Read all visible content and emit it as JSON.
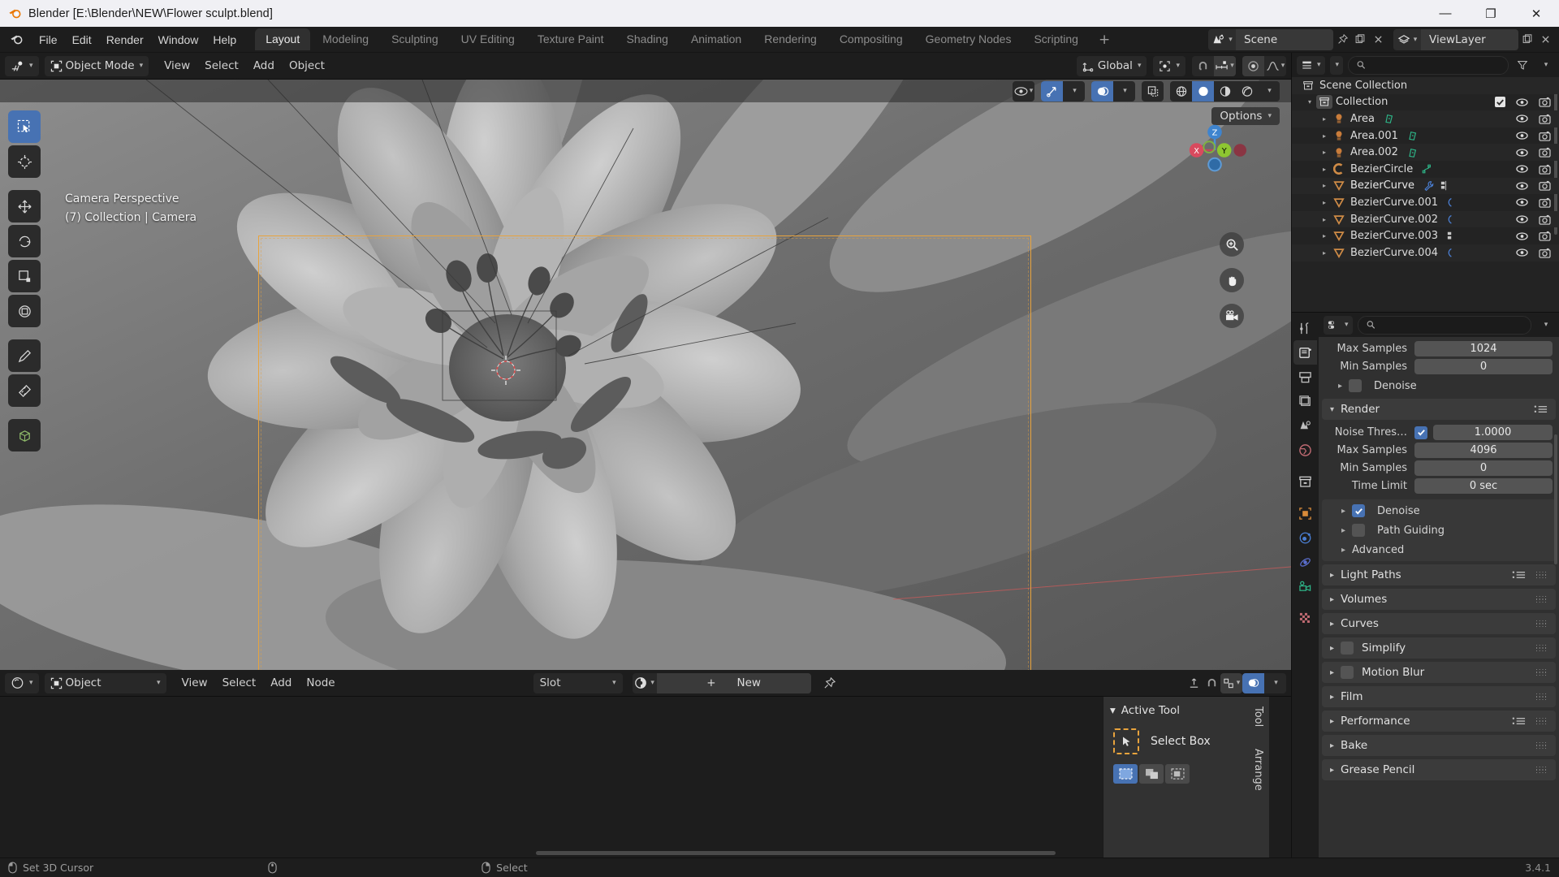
{
  "titlebar": {
    "title": "Blender [E:\\Blender\\NEW\\Flower sculpt.blend]",
    "minimize": "—",
    "maximize": "❐",
    "close": "✕"
  },
  "topbar": {
    "menus": [
      "File",
      "Edit",
      "Render",
      "Window",
      "Help"
    ],
    "workspaces": [
      {
        "label": "Layout",
        "active": true
      },
      {
        "label": "Modeling",
        "active": false
      },
      {
        "label": "Sculpting",
        "active": false
      },
      {
        "label": "UV Editing",
        "active": false
      },
      {
        "label": "Texture Paint",
        "active": false
      },
      {
        "label": "Shading",
        "active": false
      },
      {
        "label": "Animation",
        "active": false
      },
      {
        "label": "Rendering",
        "active": false
      },
      {
        "label": "Compositing",
        "active": false
      },
      {
        "label": "Geometry Nodes",
        "active": false
      },
      {
        "label": "Scripting",
        "active": false
      }
    ],
    "add_workspace": "+",
    "scene_name": "Scene",
    "viewlayer_name": "ViewLayer"
  },
  "viewport": {
    "mode": "Object Mode",
    "menus": [
      "View",
      "Select",
      "Add",
      "Object"
    ],
    "transform_orientation": "Global",
    "options_label": "Options",
    "overlay_line1": "Camera Perspective",
    "overlay_line2": "(7) Collection | Camera",
    "gizmo_axes": {
      "x": "X",
      "y": "Y",
      "z": "Z"
    },
    "accent_camera_frame": "#e8a33d",
    "accent_active": "#4772b3"
  },
  "shader_editor": {
    "editor_type": "Object",
    "menus": [
      "View",
      "Select",
      "Add",
      "Node"
    ],
    "slot_label": "Slot",
    "new_label": "New"
  },
  "npanel": {
    "title": "Active Tool",
    "tool_name": "Select Box",
    "tabs": [
      "Tool",
      "Arrange"
    ]
  },
  "outliner": {
    "search_placeholder": "",
    "rows": [
      {
        "indent": 0,
        "tri": "",
        "icon": "collection-icon",
        "name": "Scene Collection",
        "extras": [],
        "check": false,
        "eye": false,
        "cam": false
      },
      {
        "indent": 1,
        "tri": "▾",
        "icon": "collection-icon",
        "name": "Collection",
        "extras": [],
        "check": true,
        "eye": true,
        "cam": true
      },
      {
        "indent": 2,
        "tri": "▸",
        "icon": "light-icon",
        "name": "Area",
        "extras": [
          "light-data-icon"
        ],
        "eye": true,
        "cam": true
      },
      {
        "indent": 2,
        "tri": "▸",
        "icon": "light-icon",
        "name": "Area.001",
        "extras": [
          "light-data-icon"
        ],
        "eye": true,
        "cam": true
      },
      {
        "indent": 2,
        "tri": "▸",
        "icon": "light-icon",
        "name": "Area.002",
        "extras": [
          "light-data-icon"
        ],
        "eye": true,
        "cam": true
      },
      {
        "indent": 2,
        "tri": "▸",
        "icon": "curve-icon",
        "name": "BezierCircle",
        "extras": [
          "curve-data-icon"
        ],
        "eye": true,
        "cam": true
      },
      {
        "indent": 2,
        "tri": "▸",
        "icon": "mesh-icon",
        "name": "BezierCurve",
        "extras": [
          "wrench-icon",
          "modifier-icon"
        ],
        "eye": true,
        "cam": true
      },
      {
        "indent": 2,
        "tri": "▸",
        "icon": "mesh-icon",
        "name": "BezierCurve.001",
        "extras": [
          "curve-small-icon"
        ],
        "eye": true,
        "cam": true
      },
      {
        "indent": 2,
        "tri": "▸",
        "icon": "mesh-icon",
        "name": "BezierCurve.002",
        "extras": [
          "curve-small-icon"
        ],
        "eye": true,
        "cam": true
      },
      {
        "indent": 2,
        "tri": "▸",
        "icon": "mesh-icon",
        "name": "BezierCurve.003",
        "extras": [
          "modifier-icon"
        ],
        "eye": true,
        "cam": true
      },
      {
        "indent": 2,
        "tri": "▸",
        "icon": "mesh-icon",
        "name": "BezierCurve.004",
        "extras": [
          "curve-small-icon"
        ],
        "eye": true,
        "cam": true
      }
    ]
  },
  "properties": {
    "top_fields": [
      {
        "label": "Max Samples",
        "value": "1024"
      },
      {
        "label": "Min Samples",
        "value": "0"
      }
    ],
    "denoise_top": {
      "label": "Denoise",
      "checked": false
    },
    "render_panel": {
      "label": "Render",
      "expanded": true
    },
    "noise_threshold": {
      "label": "Noise Thres…",
      "checked": true,
      "value": "1.0000"
    },
    "render_fields": [
      {
        "label": "Max Samples",
        "value": "4096"
      },
      {
        "label": "Min Samples",
        "value": "0"
      },
      {
        "label": "Time Limit",
        "value": "0 sec"
      }
    ],
    "render_subs": [
      {
        "label": "Denoise",
        "checkbox": true,
        "checked": true
      },
      {
        "label": "Path Guiding",
        "checkbox": true,
        "checked": false
      },
      {
        "label": "Advanced",
        "checkbox": false,
        "checked": false
      }
    ],
    "panels": [
      {
        "label": "Light Paths",
        "checkbox": false,
        "checked": false,
        "menu": true,
        "grip": true
      },
      {
        "label": "Volumes",
        "checkbox": false,
        "checked": false,
        "menu": false,
        "grip": true
      },
      {
        "label": "Curves",
        "checkbox": false,
        "checked": false,
        "menu": false,
        "grip": true
      },
      {
        "label": "Simplify",
        "checkbox": true,
        "checked": false,
        "menu": false,
        "grip": true
      },
      {
        "label": "Motion Blur",
        "checkbox": true,
        "checked": false,
        "menu": false,
        "grip": true
      },
      {
        "label": "Film",
        "checkbox": false,
        "checked": false,
        "menu": false,
        "grip": true
      },
      {
        "label": "Performance",
        "checkbox": false,
        "checked": false,
        "menu": true,
        "grip": true
      },
      {
        "label": "Bake",
        "checkbox": false,
        "checked": false,
        "menu": false,
        "grip": true
      },
      {
        "label": "Grease Pencil",
        "checkbox": false,
        "checked": false,
        "menu": false,
        "grip": true
      }
    ]
  },
  "statusbar": {
    "item1": "Set 3D Cursor",
    "item2": "",
    "item3": "Select",
    "version": "3.4.1"
  }
}
